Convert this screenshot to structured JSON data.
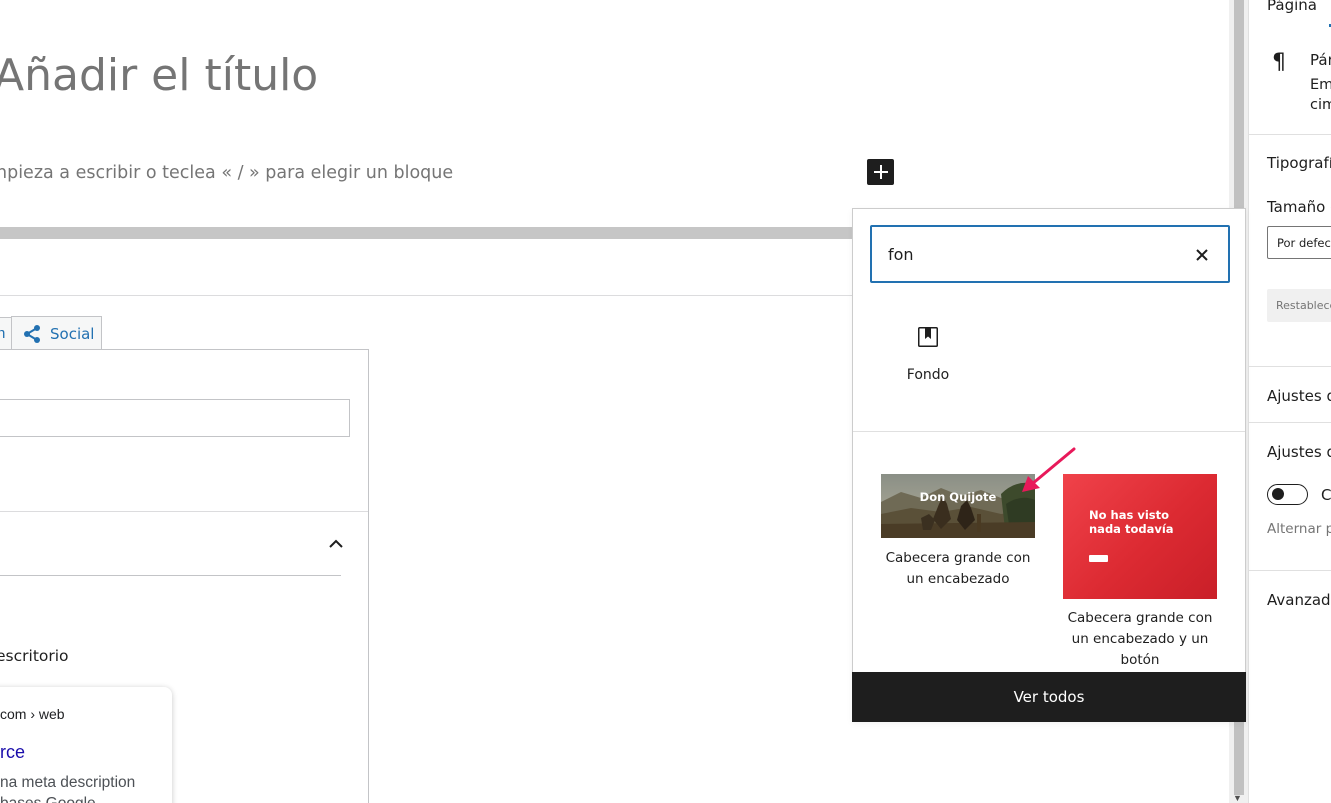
{
  "editor": {
    "title_placeholder": "Añadir el título",
    "body_placeholder": "Empieza a escribir o teclea « / » para elegir un bloque",
    "body_placeholder_visible": "npieza a escribir o teclea « / » para elegir un bloque",
    "title_visible": "Añadir el título"
  },
  "seo_box": {
    "tab_prev_visible": "n",
    "tab_social": "Social",
    "preview_mode_visible": "escritorio",
    "serp_url_visible": "com › web",
    "serp_title_visible": "rce",
    "serp_desc_line1_visible": "na meta description",
    "serp_desc_line2_visible": "bases Google"
  },
  "sidebar": {
    "page_label_visible": "Página",
    "block_name_visible": "Pár",
    "block_desc_line1_visible": "Em",
    "block_desc_line2_visible": "cim",
    "typography_visible": "Tipografía",
    "size_label_visible": "Tamaño d",
    "size_select_visible": "Por defect",
    "reset_visible": "Restablece",
    "section1_visible": "Ajustes de",
    "section2_visible": "Ajustes de",
    "toggle_label_visible": "C",
    "toggle_help_visible": "Alternar pa",
    "advanced_visible": "Avanzado"
  },
  "inserter": {
    "search_value": "fon",
    "blocks": [
      {
        "label": "Fondo",
        "icon": "cover-block-icon"
      }
    ],
    "patterns": [
      {
        "label": "Cabecera grande con un encabezado",
        "thumb_heading": "Don Quijote"
      },
      {
        "label": "Cabecera grande con un encabezado y un botón",
        "thumb_heading_line1": "No has visto",
        "thumb_heading_line2": "nada todavía"
      }
    ],
    "view_all": "Ver todos"
  },
  "colors": {
    "accent": "#2271b1",
    "arrow": "#e8195a",
    "pattern_red": "#e0303a",
    "dark": "#1e1e1e"
  }
}
